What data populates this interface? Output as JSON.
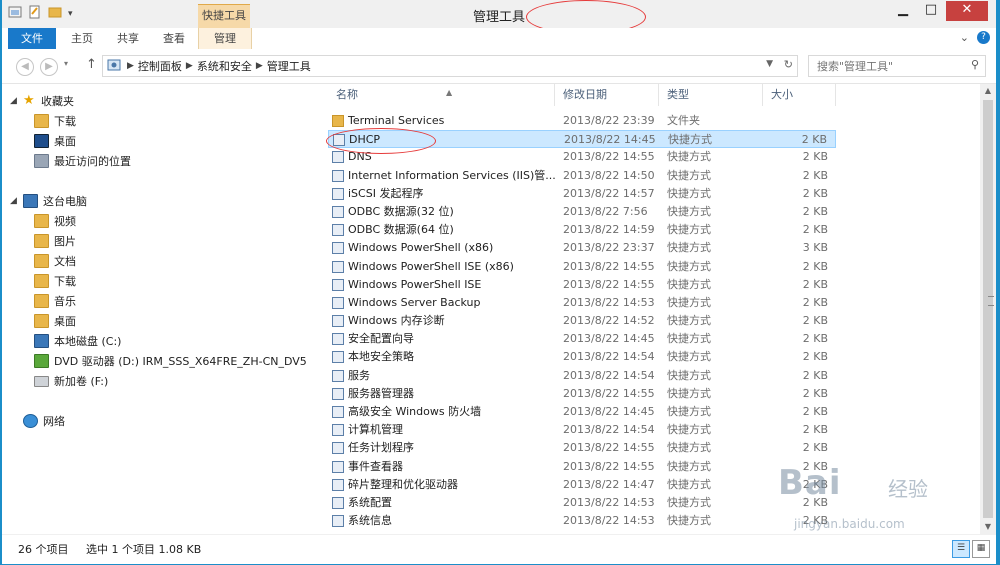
{
  "window": {
    "title": "管理工具",
    "context_tab_title": "快捷工具",
    "controls": {
      "minimize": "▁",
      "maximize": "□",
      "close": "✕"
    }
  },
  "ribbon": {
    "tabs": [
      "文件",
      "主页",
      "共享",
      "查看",
      "管理"
    ],
    "expand_icon": "chevron-down-icon",
    "help_icon": "help-icon"
  },
  "address": {
    "crumbs": [
      "控制面板",
      "系统和安全",
      "管理工具"
    ],
    "search_placeholder": "搜索\"管理工具\""
  },
  "nav": {
    "favorites_label": "收藏夹",
    "favorites": [
      "下载",
      "桌面",
      "最近访问的位置"
    ],
    "pc_label": "这台电脑",
    "pc_items": [
      "视频",
      "图片",
      "文档",
      "下载",
      "音乐",
      "桌面",
      "本地磁盘 (C:)",
      "DVD 驱动器 (D:) IRM_SSS_X64FRE_ZH-CN_DV5",
      "新加卷 (F:)"
    ],
    "network_label": "网络"
  },
  "columns": {
    "name": "名称",
    "date": "修改日期",
    "type": "类型",
    "size": "大小"
  },
  "files": [
    {
      "name": "Terminal Services",
      "date": "2013/8/22 23:39",
      "type": "文件夹",
      "size": "",
      "icon": "folder"
    },
    {
      "name": "DHCP",
      "date": "2013/8/22 14:45",
      "type": "快捷方式",
      "size": "2 KB",
      "icon": "shortcut"
    },
    {
      "name": "DNS",
      "date": "2013/8/22 14:55",
      "type": "快捷方式",
      "size": "2 KB",
      "icon": "shortcut"
    },
    {
      "name": "Internet Information Services (IIS)管...",
      "date": "2013/8/22 14:50",
      "type": "快捷方式",
      "size": "2 KB",
      "icon": "shortcut"
    },
    {
      "name": "iSCSI 发起程序",
      "date": "2013/8/22 14:57",
      "type": "快捷方式",
      "size": "2 KB",
      "icon": "shortcut"
    },
    {
      "name": "ODBC 数据源(32 位)",
      "date": "2013/8/22 7:56",
      "type": "快捷方式",
      "size": "2 KB",
      "icon": "shortcut"
    },
    {
      "name": "ODBC 数据源(64 位)",
      "date": "2013/8/22 14:59",
      "type": "快捷方式",
      "size": "2 KB",
      "icon": "shortcut"
    },
    {
      "name": "Windows PowerShell (x86)",
      "date": "2013/8/22 23:37",
      "type": "快捷方式",
      "size": "3 KB",
      "icon": "shortcut"
    },
    {
      "name": "Windows PowerShell ISE (x86)",
      "date": "2013/8/22 14:55",
      "type": "快捷方式",
      "size": "2 KB",
      "icon": "shortcut"
    },
    {
      "name": "Windows PowerShell ISE",
      "date": "2013/8/22 14:55",
      "type": "快捷方式",
      "size": "2 KB",
      "icon": "shortcut"
    },
    {
      "name": "Windows Server Backup",
      "date": "2013/8/22 14:53",
      "type": "快捷方式",
      "size": "2 KB",
      "icon": "shortcut"
    },
    {
      "name": "Windows 内存诊断",
      "date": "2013/8/22 14:52",
      "type": "快捷方式",
      "size": "2 KB",
      "icon": "shortcut"
    },
    {
      "name": "安全配置向导",
      "date": "2013/8/22 14:45",
      "type": "快捷方式",
      "size": "2 KB",
      "icon": "shortcut"
    },
    {
      "name": "本地安全策略",
      "date": "2013/8/22 14:54",
      "type": "快捷方式",
      "size": "2 KB",
      "icon": "shortcut"
    },
    {
      "name": "服务",
      "date": "2013/8/22 14:54",
      "type": "快捷方式",
      "size": "2 KB",
      "icon": "shortcut"
    },
    {
      "name": "服务器管理器",
      "date": "2013/8/22 14:55",
      "type": "快捷方式",
      "size": "2 KB",
      "icon": "shortcut"
    },
    {
      "name": "高级安全 Windows 防火墙",
      "date": "2013/8/22 14:45",
      "type": "快捷方式",
      "size": "2 KB",
      "icon": "shortcut"
    },
    {
      "name": "计算机管理",
      "date": "2013/8/22 14:54",
      "type": "快捷方式",
      "size": "2 KB",
      "icon": "shortcut"
    },
    {
      "name": "任务计划程序",
      "date": "2013/8/22 14:55",
      "type": "快捷方式",
      "size": "2 KB",
      "icon": "shortcut"
    },
    {
      "name": "事件查看器",
      "date": "2013/8/22 14:55",
      "type": "快捷方式",
      "size": "2 KB",
      "icon": "shortcut"
    },
    {
      "name": "碎片整理和优化驱动器",
      "date": "2013/8/22 14:47",
      "type": "快捷方式",
      "size": "2 KB",
      "icon": "shortcut"
    },
    {
      "name": "系统配置",
      "date": "2013/8/22 14:53",
      "type": "快捷方式",
      "size": "2 KB",
      "icon": "shortcut"
    },
    {
      "name": "系统信息",
      "date": "2013/8/22 14:53",
      "type": "快捷方式",
      "size": "2 KB",
      "icon": "shortcut"
    }
  ],
  "selected_index": 1,
  "status": {
    "count": "26 个项目",
    "selection": "选中 1 个项目  1.08 KB"
  },
  "watermark": {
    "brand": "Bai",
    "cn": "经验",
    "url": "jingyan.baidu.com"
  },
  "colors": {
    "accent": "#1979ca",
    "selection": "#cce8ff",
    "annotation": "#e63b3b"
  }
}
